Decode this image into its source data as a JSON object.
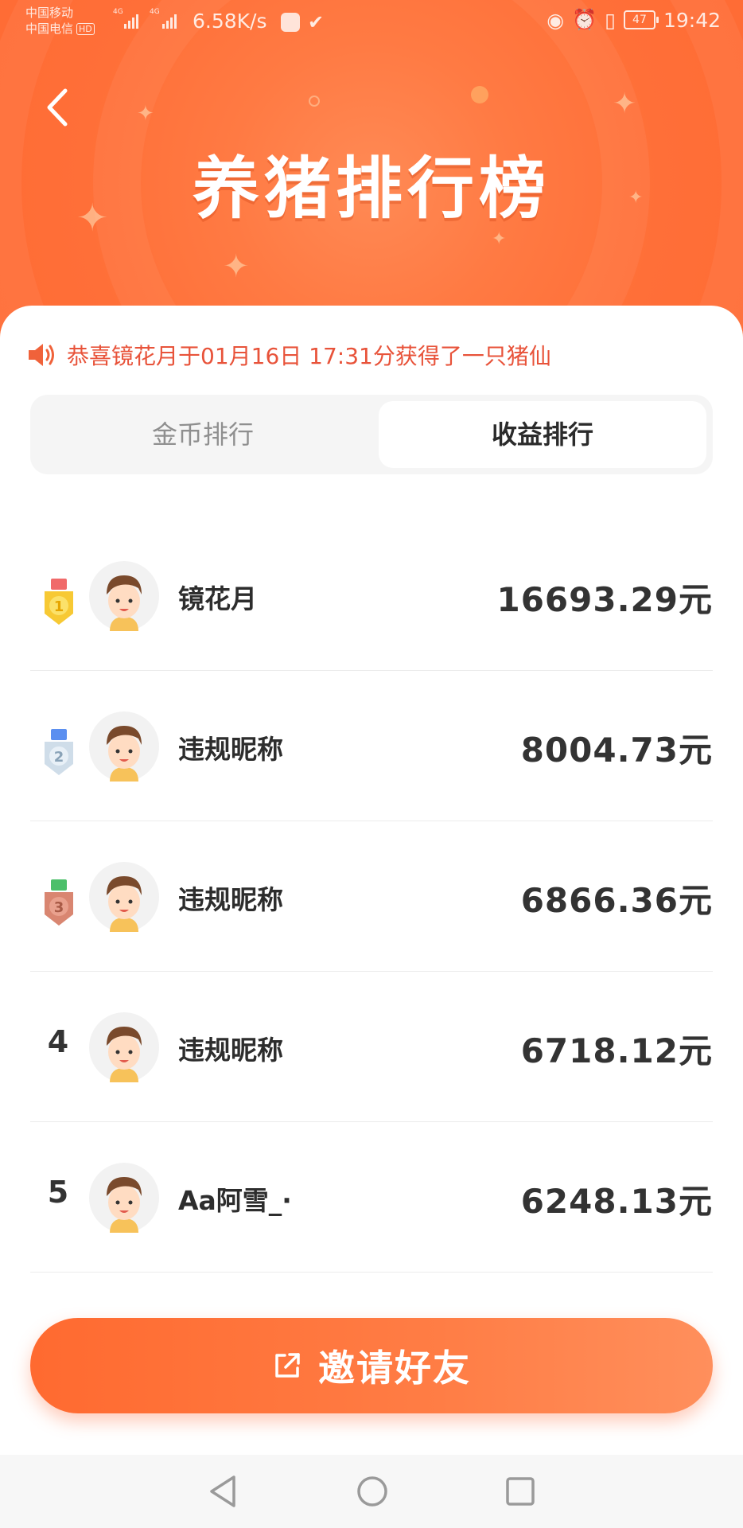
{
  "status_bar": {
    "carrier1": "中国移动",
    "carrier2": "中国电信",
    "hd": "HD",
    "net1": "4G",
    "net2": "4G",
    "speed": "6.58K/s",
    "battery": "47",
    "time": "19:42"
  },
  "header": {
    "title": "养猪排行榜"
  },
  "notice": {
    "text": "恭喜镜花月于01月16日 17:31分获得了一只猪仙"
  },
  "tabs": [
    {
      "label": "金币排行",
      "selected": false
    },
    {
      "label": "收益排行",
      "selected": true
    }
  ],
  "rankings": [
    {
      "rank": "1",
      "medal": "gold",
      "name": "镜花月",
      "amount": "16693.29元"
    },
    {
      "rank": "2",
      "medal": "silver",
      "name": "违规昵称",
      "amount": "8004.73元"
    },
    {
      "rank": "3",
      "medal": "bronze",
      "name": "违规昵称",
      "amount": "6866.36元"
    },
    {
      "rank": "4",
      "medal": "",
      "name": "违规昵称",
      "amount": "6718.12元"
    },
    {
      "rank": "5",
      "medal": "",
      "name": "Aa阿雪_·",
      "amount": "6248.13元"
    }
  ],
  "invite": {
    "label": "邀请好友"
  },
  "colors": {
    "brand_orange": "#ff6f38",
    "notice_red": "#e8533a",
    "medal_gold": "#f7c934",
    "medal_silver": "#cfdde9",
    "medal_bronze": "#d98671"
  }
}
